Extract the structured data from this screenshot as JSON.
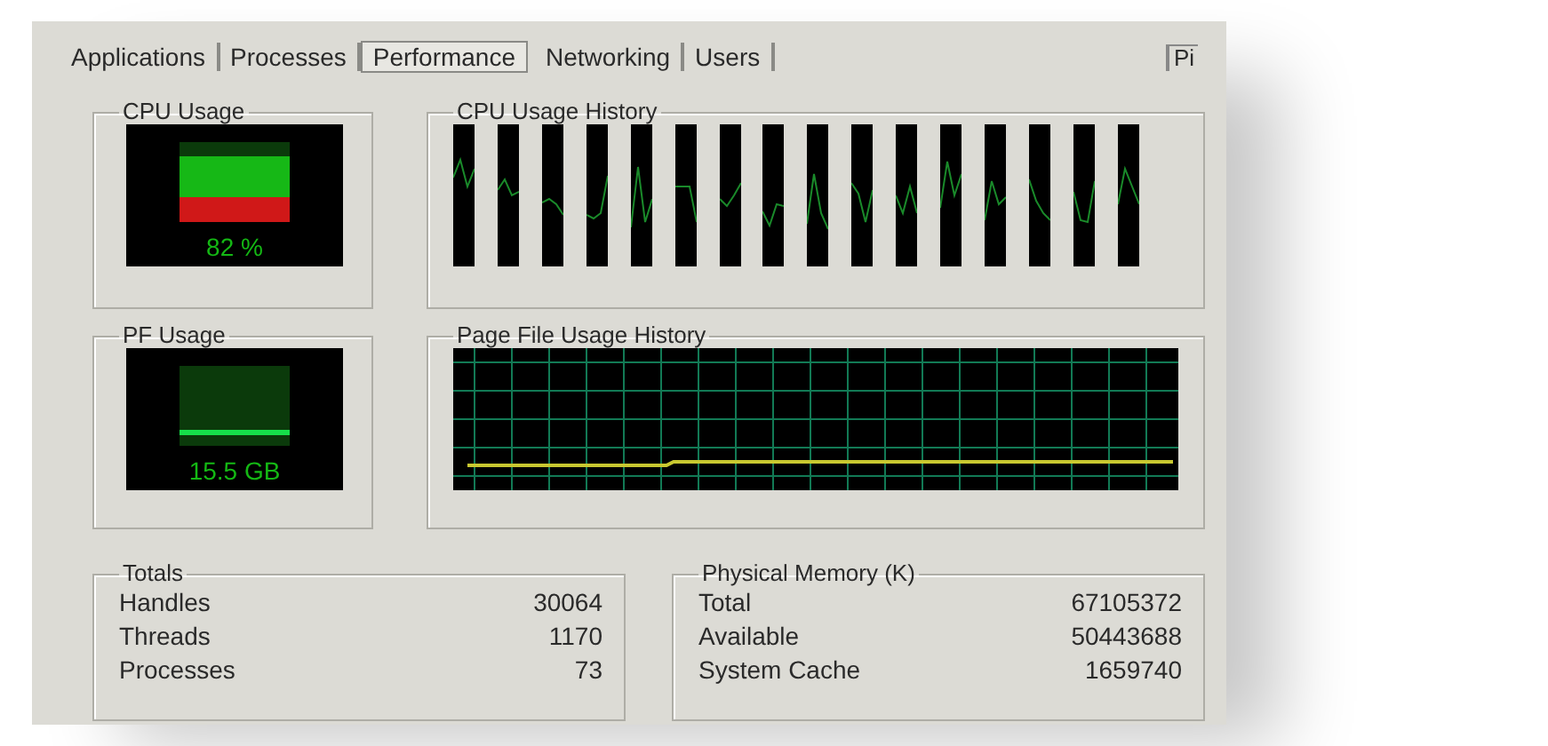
{
  "tabs": [
    {
      "label": "Applications",
      "selected": false
    },
    {
      "label": "Processes",
      "selected": false
    },
    {
      "label": "Performance",
      "selected": true
    },
    {
      "label": "Networking",
      "selected": false
    },
    {
      "label": "Users",
      "selected": false
    }
  ],
  "corner_label": "Pi",
  "cpu_usage": {
    "title": "CPU Usage",
    "reading": "82 %"
  },
  "cpu_history": {
    "title": "CPU Usage History"
  },
  "pf_usage": {
    "title": "PF Usage",
    "reading": "15.5 GB"
  },
  "pf_history": {
    "title": "Page File Usage History"
  },
  "totals": {
    "title": "Totals",
    "rows": [
      {
        "label": "Handles",
        "value": "30064"
      },
      {
        "label": "Threads",
        "value": "1170"
      },
      {
        "label": "Processes",
        "value": "73"
      }
    ]
  },
  "physical_memory": {
    "title": "Physical Memory (K)",
    "rows": [
      {
        "label": "Total",
        "value": "67105372"
      },
      {
        "label": "Available",
        "value": "50443688"
      },
      {
        "label": "System Cache",
        "value": "1659740"
      }
    ]
  }
}
